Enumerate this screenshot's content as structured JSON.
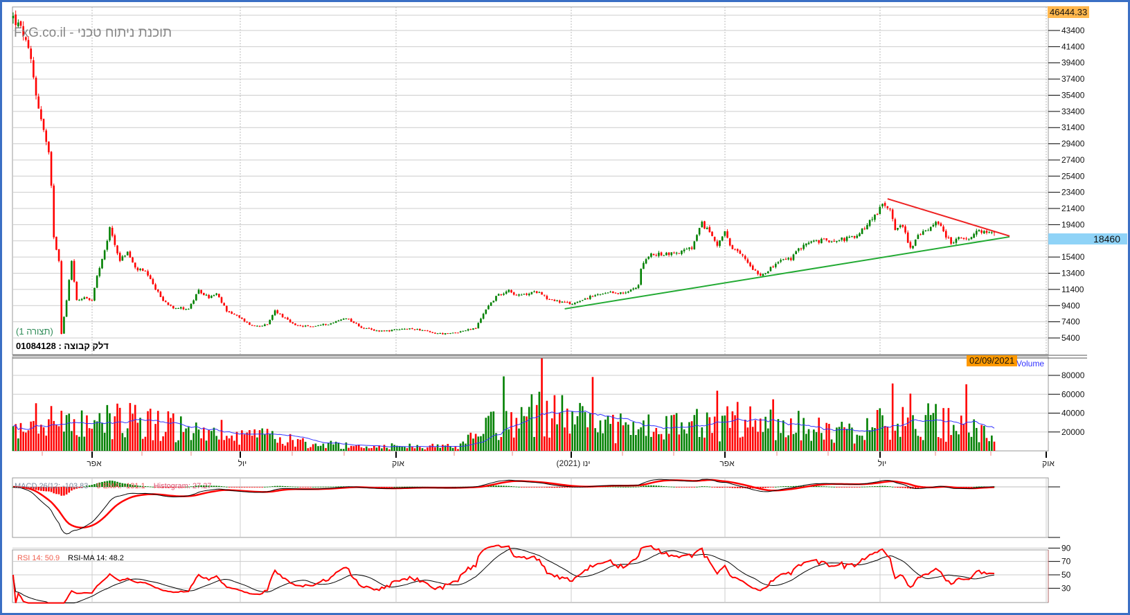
{
  "header": {
    "watermark": "תוכנת ניתוח טכני - FxG.co.il",
    "configuration": "(תצורה 1)",
    "symbol": "דלק קבוצה : 01084128"
  },
  "labels": {
    "max_price": "46444.33",
    "last_price": "18460",
    "current_date": "02/09/2021",
    "volume": "Volume",
    "macd": "MACD 26/12: -103.83",
    "ema": "9 EMA: -131.1",
    "histogram": "Histogram: 27.27",
    "rsi": "RSI 14: 50.9",
    "rsi_ma": "RSI-MA 14:  48.2"
  },
  "x_axis": {
    "months": [
      "אפר",
      "יול",
      "אוק",
      "ינו (2021)",
      "אפר",
      "יול",
      "אוק"
    ]
  },
  "colors": {
    "up": "#008000",
    "down": "#ff0000",
    "volume_ma": "#3333ff",
    "support": "#22aa33",
    "resistance": "#ee2222",
    "border": "#3a6fc4"
  },
  "chart_data": {
    "type": "candlestick",
    "title": "דלק קבוצה 01084128",
    "x_unit": "trading day index (Feb 2020 – Sep 2021)",
    "price_axis": {
      "ticks": [
        43400,
        41400,
        39400,
        37400,
        35400,
        33400,
        31400,
        29400,
        27400,
        25400,
        23400,
        21400,
        19400,
        17400,
        15400,
        13400,
        11400,
        9400,
        7400,
        5400
      ]
    },
    "volume_axis": {
      "ticks": [
        80000,
        60000,
        40000,
        20000
      ]
    },
    "rsi_axis": {
      "ticks": [
        90,
        70,
        50,
        30
      ]
    },
    "close_keypoints": [
      [
        0,
        45000
      ],
      [
        4,
        43000
      ],
      [
        7,
        39500
      ],
      [
        9,
        35500
      ],
      [
        12,
        31000
      ],
      [
        14,
        28000
      ],
      [
        15,
        24000
      ],
      [
        16,
        18000
      ],
      [
        18,
        15000
      ],
      [
        19,
        6000
      ],
      [
        21,
        10000
      ],
      [
        23,
        15000
      ],
      [
        25,
        10000
      ],
      [
        28,
        10500
      ],
      [
        31,
        10000
      ],
      [
        33,
        13000
      ],
      [
        36,
        16000
      ],
      [
        38,
        19000
      ],
      [
        40,
        17000
      ],
      [
        42,
        15000
      ],
      [
        45,
        16000
      ],
      [
        48,
        14000
      ],
      [
        52,
        13500
      ],
      [
        56,
        11500
      ],
      [
        59,
        10000
      ],
      [
        63,
        9200
      ],
      [
        69,
        9000
      ],
      [
        73,
        11200
      ],
      [
        77,
        10400
      ],
      [
        80,
        10800
      ],
      [
        84,
        8800
      ],
      [
        89,
        7900
      ],
      [
        94,
        6900
      ],
      [
        100,
        7000
      ],
      [
        103,
        8800
      ],
      [
        107,
        7800
      ],
      [
        111,
        6900
      ],
      [
        117,
        6800
      ],
      [
        125,
        7200
      ],
      [
        131,
        7900
      ],
      [
        137,
        6700
      ],
      [
        142,
        6300
      ],
      [
        148,
        6300
      ],
      [
        154,
        6500
      ],
      [
        159,
        6500
      ],
      [
        165,
        6000
      ],
      [
        171,
        5900
      ],
      [
        176,
        6200
      ],
      [
        182,
        6600
      ],
      [
        186,
        9000
      ],
      [
        190,
        10500
      ],
      [
        195,
        11400
      ],
      [
        198,
        10600
      ],
      [
        202,
        10800
      ],
      [
        207,
        11200
      ],
      [
        210,
        10300
      ],
      [
        216,
        9800
      ],
      [
        220,
        9600
      ],
      [
        224,
        10200
      ],
      [
        230,
        10700
      ],
      [
        236,
        11000
      ],
      [
        241,
        10900
      ],
      [
        246,
        12000
      ],
      [
        247,
        14000
      ],
      [
        250,
        15600
      ],
      [
        256,
        15800
      ],
      [
        261,
        15900
      ],
      [
        267,
        16500
      ],
      [
        271,
        19500
      ],
      [
        274,
        18500
      ],
      [
        277,
        17000
      ],
      [
        280,
        18500
      ],
      [
        282,
        16600
      ],
      [
        287,
        15500
      ],
      [
        291,
        14000
      ],
      [
        294,
        13200
      ],
      [
        298,
        14000
      ],
      [
        302,
        15000
      ],
      [
        306,
        15200
      ],
      [
        311,
        17000
      ],
      [
        315,
        17300
      ],
      [
        321,
        17500
      ],
      [
        326,
        17600
      ],
      [
        332,
        17900
      ],
      [
        336,
        19500
      ],
      [
        339,
        20500
      ],
      [
        342,
        21800
      ],
      [
        345,
        21500
      ],
      [
        347,
        19000
      ],
      [
        350,
        19200
      ],
      [
        353,
        16500
      ],
      [
        356,
        18000
      ],
      [
        360,
        18800
      ],
      [
        363,
        20000
      ],
      [
        366,
        18500
      ],
      [
        369,
        17200
      ],
      [
        373,
        17800
      ],
      [
        376,
        17400
      ],
      [
        380,
        18800
      ],
      [
        383,
        18300
      ],
      [
        386,
        18460
      ]
    ],
    "volume_ma_keypoints": [
      [
        0,
        22000
      ],
      [
        25,
        35000
      ],
      [
        45,
        38000
      ],
      [
        65,
        28000
      ],
      [
        80,
        15000
      ],
      [
        100,
        15000
      ],
      [
        120,
        8000
      ],
      [
        140,
        5000
      ],
      [
        175,
        5000
      ],
      [
        190,
        30000
      ],
      [
        210,
        45000
      ],
      [
        230,
        25000
      ],
      [
        255,
        25000
      ],
      [
        280,
        30000
      ],
      [
        300,
        35000
      ],
      [
        320,
        20000
      ],
      [
        340,
        28000
      ],
      [
        355,
        40000
      ],
      [
        386,
        15000
      ]
    ],
    "trendlines": [
      {
        "name": "support",
        "from": [
          217,
          9000
        ],
        "to": [
          392,
          17900
        ]
      },
      {
        "name": "resistance",
        "from": [
          344,
          22600
        ],
        "to": [
          392,
          18000
        ]
      }
    ],
    "indicators": {
      "macd": {
        "fast": 12,
        "slow": 26,
        "signal": 9,
        "value": -103.83,
        "signal_value": -131.1,
        "histogram": 27.27
      },
      "rsi": {
        "period": 14,
        "value": 50.9,
        "ma_period": 14,
        "ma_value": 48.2
      }
    }
  }
}
